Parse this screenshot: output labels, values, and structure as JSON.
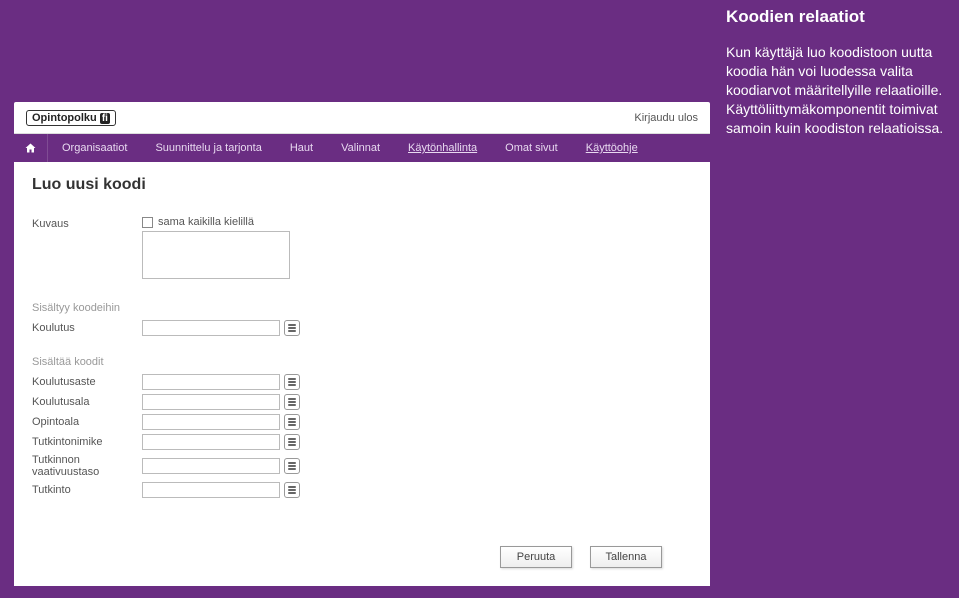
{
  "sidebar": {
    "title": "Koodien relaatiot",
    "body": "Kun käyttäjä luo koodistoon uutta koodia hän voi luodessa valita koodiarvot määritellyille relaatioille. Käyttöliittymäkomponentit toimivat samoin kuin koodiston relaatioissa."
  },
  "logo": {
    "name": "Opintopolku",
    "suffix": "fi"
  },
  "logout": "Kirjaudu ulos",
  "nav": {
    "items": [
      {
        "label": "Organisaatiot"
      },
      {
        "label": "Suunnittelu ja tarjonta"
      },
      {
        "label": "Haut"
      },
      {
        "label": "Valinnat"
      },
      {
        "label": "Käytönhallinta",
        "underlined": true
      },
      {
        "label": "Omat sivut"
      },
      {
        "label": "Käyttöohje",
        "underlined": true
      }
    ]
  },
  "page": {
    "title": "Luo uusi koodi"
  },
  "desc": {
    "label": "Kuvaus",
    "same_lang": "sama kaikilla kielillä",
    "value": ""
  },
  "sections": {
    "contained_in": "Sisältyy koodeihin",
    "contains": "Sisältää koodit"
  },
  "relations": {
    "koulutus": {
      "label": "Koulutus",
      "value": ""
    },
    "koulutusaste": {
      "label": "Koulutusaste",
      "value": ""
    },
    "koulutusala": {
      "label": "Koulutusala",
      "value": ""
    },
    "opintoala": {
      "label": "Opintoala",
      "value": ""
    },
    "tutkintonimike": {
      "label": "Tutkintonimike",
      "value": ""
    },
    "tutkinnon_vaativuustaso": {
      "label": "Tutkinnon vaativuustaso",
      "value": ""
    },
    "tutkinto": {
      "label": "Tutkinto",
      "value": ""
    }
  },
  "buttons": {
    "cancel": "Peruuta",
    "save": "Tallenna"
  }
}
